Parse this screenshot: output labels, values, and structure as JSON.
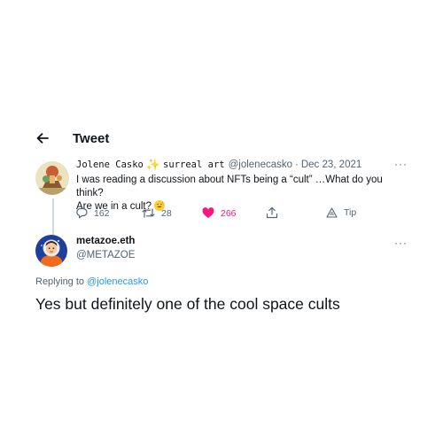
{
  "header": {
    "title": "Tweet",
    "back_icon": "arrow-left-icon"
  },
  "parent_tweet": {
    "display_name": "Jolene Casko",
    "name_suffix": "surreal art",
    "handle": "@jolenecasko",
    "separator": "·",
    "date": "Dec 23, 2021",
    "text_line1": "I was reading a discussion about NFTs being a “cult” …What do you think?",
    "text_line2": "Are we in a cult?",
    "more": "···",
    "actions": {
      "replies": "162",
      "retweets": "28",
      "likes": "266",
      "tip_label": "Tip"
    },
    "like_color": "#f91880"
  },
  "reply_tweet": {
    "display_name": "metazoe.eth",
    "handle": "@METAZOE",
    "more": "···",
    "replying_prefix": "Replying to",
    "replying_handle": "@jolenecasko",
    "text": "Yes but definitely one of the cool space cults"
  },
  "colors": {
    "link": "#1d9bf0",
    "secondary_text": "#536471",
    "primary_text": "#0f1419"
  }
}
